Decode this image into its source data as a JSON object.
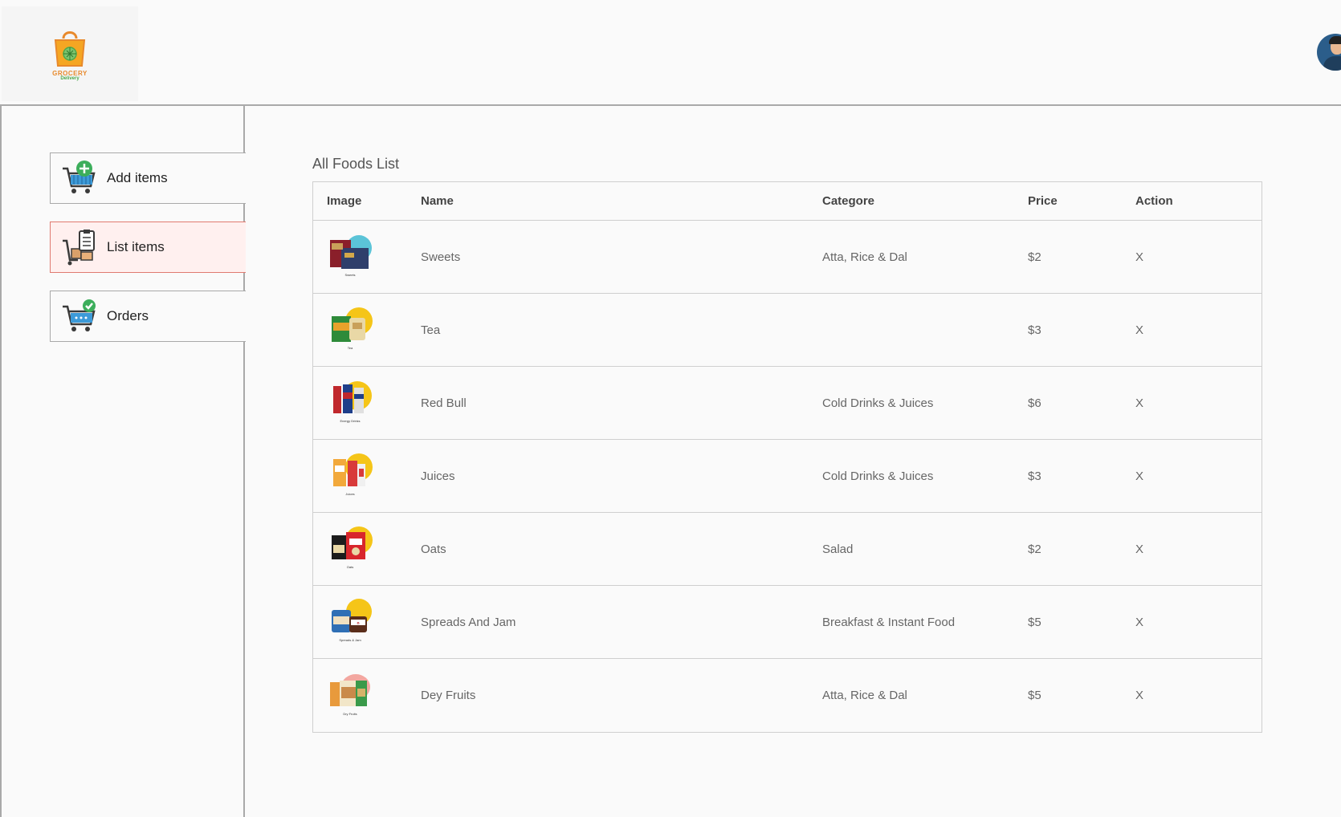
{
  "header": {
    "logo_line1": "GROCERY",
    "logo_line2": "Delivery"
  },
  "sidebar": {
    "items": [
      {
        "label": "Add items",
        "icon": "cart-add-icon",
        "active": false
      },
      {
        "label": "List items",
        "icon": "list-clipboard-icon",
        "active": true
      },
      {
        "label": "Orders",
        "icon": "cart-check-icon",
        "active": false
      }
    ]
  },
  "list": {
    "title": "All Foods List",
    "columns": [
      "Image",
      "Name",
      "Categore",
      "Price",
      "Action"
    ],
    "rows": [
      {
        "name": "Sweets",
        "category": "Atta, Rice & Dal",
        "price": "$2",
        "action": "X",
        "thumb_caption": "Sweets"
      },
      {
        "name": "Tea",
        "category": "",
        "price": "$3",
        "action": "X",
        "thumb_caption": "Tea"
      },
      {
        "name": "Red Bull",
        "category": "Cold Drinks & Juices",
        "price": "$6",
        "action": "X",
        "thumb_caption": "Energy Drinks"
      },
      {
        "name": "Juices",
        "category": "Cold Drinks & Juices",
        "price": "$3",
        "action": "X",
        "thumb_caption": "Juices"
      },
      {
        "name": "Oats",
        "category": "Salad",
        "price": "$2",
        "action": "X",
        "thumb_caption": "Oats"
      },
      {
        "name": "Spreads And Jam",
        "category": "Breakfast & Instant Food",
        "price": "$5",
        "action": "X",
        "thumb_caption": "Spreads & Jam"
      },
      {
        "name": "Dey Fruits",
        "category": "Atta, Rice & Dal",
        "price": "$5",
        "action": "X",
        "thumb_caption": "Dry Fruits"
      }
    ]
  },
  "colors": {
    "active_bg": "#fff0ef",
    "active_border": "#e07a70",
    "border": "#a9a9a9",
    "logo_orange": "#e8892b",
    "logo_green": "#4aa84a"
  }
}
